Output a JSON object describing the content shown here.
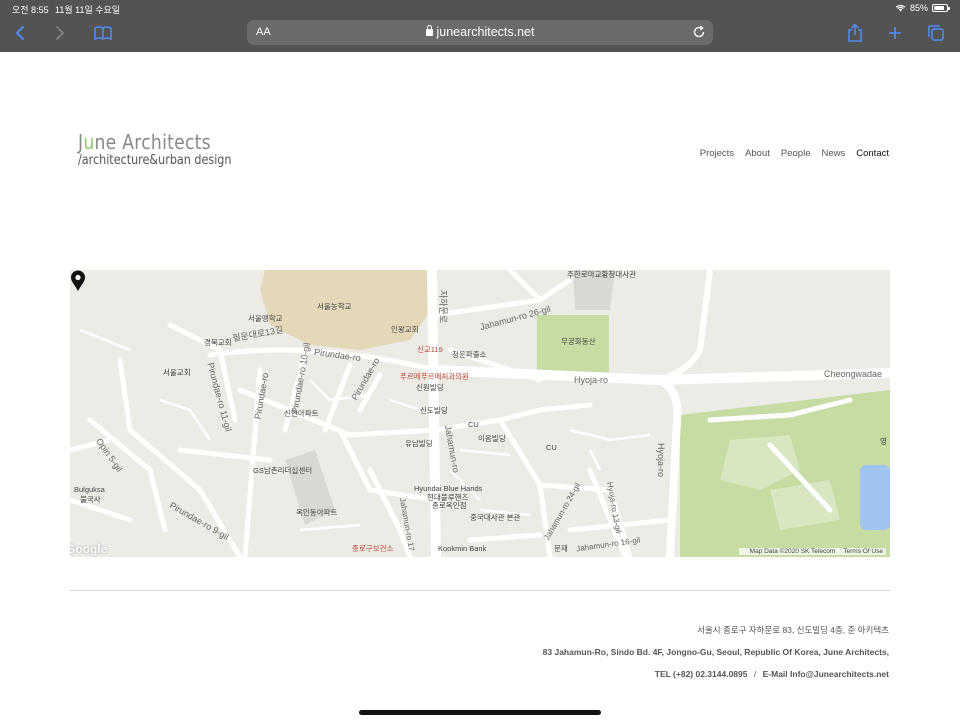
{
  "status_bar": {
    "time": "오전 8:55",
    "date": "11월 11일 수요일",
    "battery_text": "85%",
    "battery_level": 0.85
  },
  "toolbar": {
    "address_aa": "AA",
    "url": "junearchitects.net",
    "accent_color": "#4f8ef7"
  },
  "site": {
    "logo_line1_a": "J",
    "logo_line1_accent": "u",
    "logo_line1_b": "ne Architects",
    "logo_line2": "/architecture&urban design",
    "nav": [
      "Projects",
      "About",
      "People",
      "News",
      "Contact"
    ],
    "active_nav": "Contact"
  },
  "map": {
    "labels": {
      "jahamun_ro_v": "자하문로",
      "jahamun26": "Jahamun-ro 26-gil",
      "hyoja_ro": "Hyoja-ro",
      "cheongwadae": "Cheongwadae",
      "pirundae_ro": "Pirundae-ro",
      "pirundae_10": "Pirundae-ro 10-gil",
      "pirundae_11": "Pirundae-ro 11-gil",
      "pirundae_9": "Pirundae-ro 9-gil",
      "pirundae_kr": "필운대로13길",
      "pirundae_left": "Pirundae-ro",
      "opin": "Opin 5-gil",
      "jahamun_ro": "Jahamun-ro",
      "jahamun_17": "Jahamun-ro 17",
      "jahamun_24": "Jahamun-ro 24-gil",
      "jahamun_16": "Jahamun-ro 16-gil",
      "hyoja_13": "Hyoja-ro 13-gil",
      "hyoja_v": "Hyoja-ro",
      "gyeongbok_palace": "주한로마교황청대사관",
      "seoul_maenghakgyo": "서울맹학교",
      "seoul_nonghakgyo": "서울농학교",
      "inwang_church": "인왕교회",
      "gyeongbuk_church": "경북교회",
      "seoul_church": "서울교회",
      "singyo119": "신교119",
      "cheongun": "청운파출소",
      "purewe": "푸르메푸르메치과의원",
      "sinwon": "신원빌딩",
      "sindo": "신도빌딩",
      "cu1": "CU",
      "cu2": "CU",
      "ieum": "이음빌딩",
      "yunam": "유남빌딩",
      "sinhyeon": "신현아파트",
      "gs": "GS남촌리더십센터",
      "bulguksa_en": "Bulguksa",
      "bulguksa_kr": "불국사",
      "okin": "옥인동아파트",
      "hyundai_en": "Hyundai Blue Hands",
      "hyundai_kr": "현대블루핸즈",
      "jongno_okin": "종로옥인점",
      "chinese_embassy": "중국대사관 본관",
      "jongno_health": "종로구보건소",
      "kookmin": "Kookmin Bank",
      "kookmin_kr": "KB국민은행",
      "munjae": "문재",
      "mugung": "무궁화동산",
      "yeong": "영"
    },
    "credit_data": "Map Data ©2020 SK Telecom",
    "credit_terms": "Terms Of Use",
    "google": "Google"
  },
  "footer": {
    "line1": "서울시 종로구 자하문로 83, 신도빌딩 4층, 준 아키텍츠",
    "line2": "83 Jahamun-Ro, Sindo Bd. 4F, Jongno-Gu, Seoul, Republic Of Korea, June Architects,",
    "tel_label": "TEL",
    "tel": "(+82) 02.3144.0895",
    "sep": "/",
    "email_label": "E-Mail",
    "email": "Info@Junearchitects.net"
  }
}
